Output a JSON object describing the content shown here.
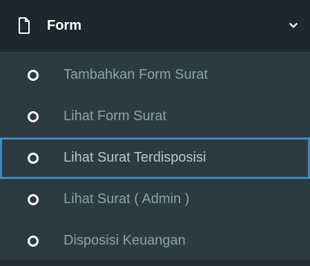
{
  "header": {
    "icon": "file-icon",
    "label": "Form",
    "chevron": "chevron-down-icon"
  },
  "menu": {
    "items": [
      {
        "label": "Tambahkan Form Surat",
        "icon": "circle-outline-icon",
        "selected": false
      },
      {
        "label": "Lihat Form Surat",
        "icon": "circle-outline-icon",
        "selected": false
      },
      {
        "label": "Lihat Surat Terdisposisi",
        "icon": "circle-outline-icon",
        "selected": true
      },
      {
        "label": "Lihat Surat ( Admin )",
        "icon": "circle-outline-icon",
        "selected": false
      },
      {
        "label": "Disposisi Keuangan",
        "icon": "circle-outline-icon",
        "selected": false
      }
    ]
  },
  "colors": {
    "header_bg": "#1e282c",
    "menu_bg": "#2c3b41",
    "item_text": "#8aa4af",
    "selected_text": "#b8c7ce",
    "focus_border": "#3c8dbc",
    "icon": "#ffffff"
  }
}
